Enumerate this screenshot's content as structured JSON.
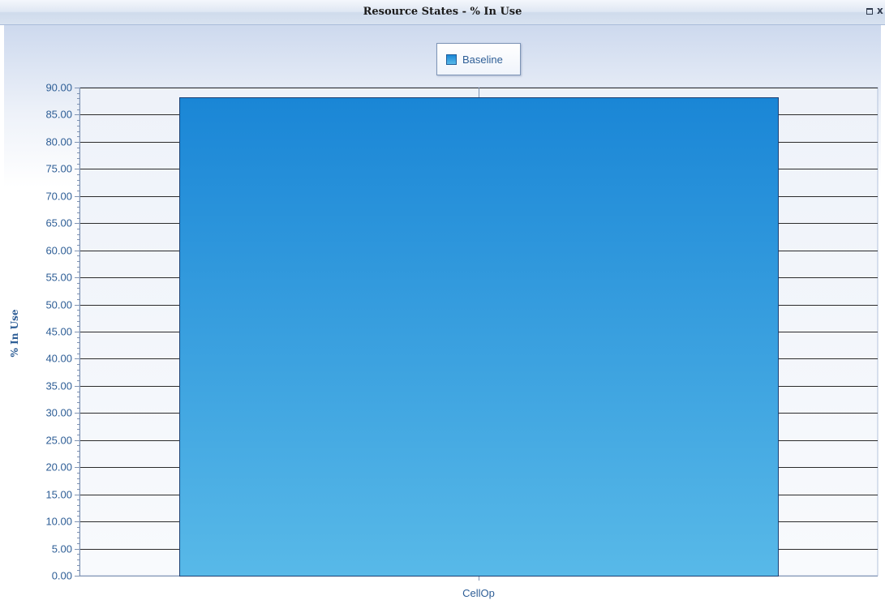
{
  "window": {
    "title": "Resource States - % In Use",
    "restore_icon": "restore-icon",
    "close_icon": "close-icon",
    "close_glyph": "x"
  },
  "chart_data": {
    "type": "bar",
    "title": "",
    "categories": [
      "CellOp"
    ],
    "series": [
      {
        "name": "Baseline",
        "values": [
          88.2
        ]
      }
    ],
    "xlabel": "",
    "ylabel": "% In Use",
    "ylim": [
      0,
      90
    ],
    "ytick_step": 5,
    "ytick_decimals": 2,
    "grid": true,
    "legend_position": "top-center",
    "colors": {
      "bar_top": "#1a86d6",
      "bar_bottom": "#58b9e8",
      "bar_border": "#1b3f73",
      "tick_label": "#2e5e96",
      "gridline": "#2b2b2b"
    }
  }
}
